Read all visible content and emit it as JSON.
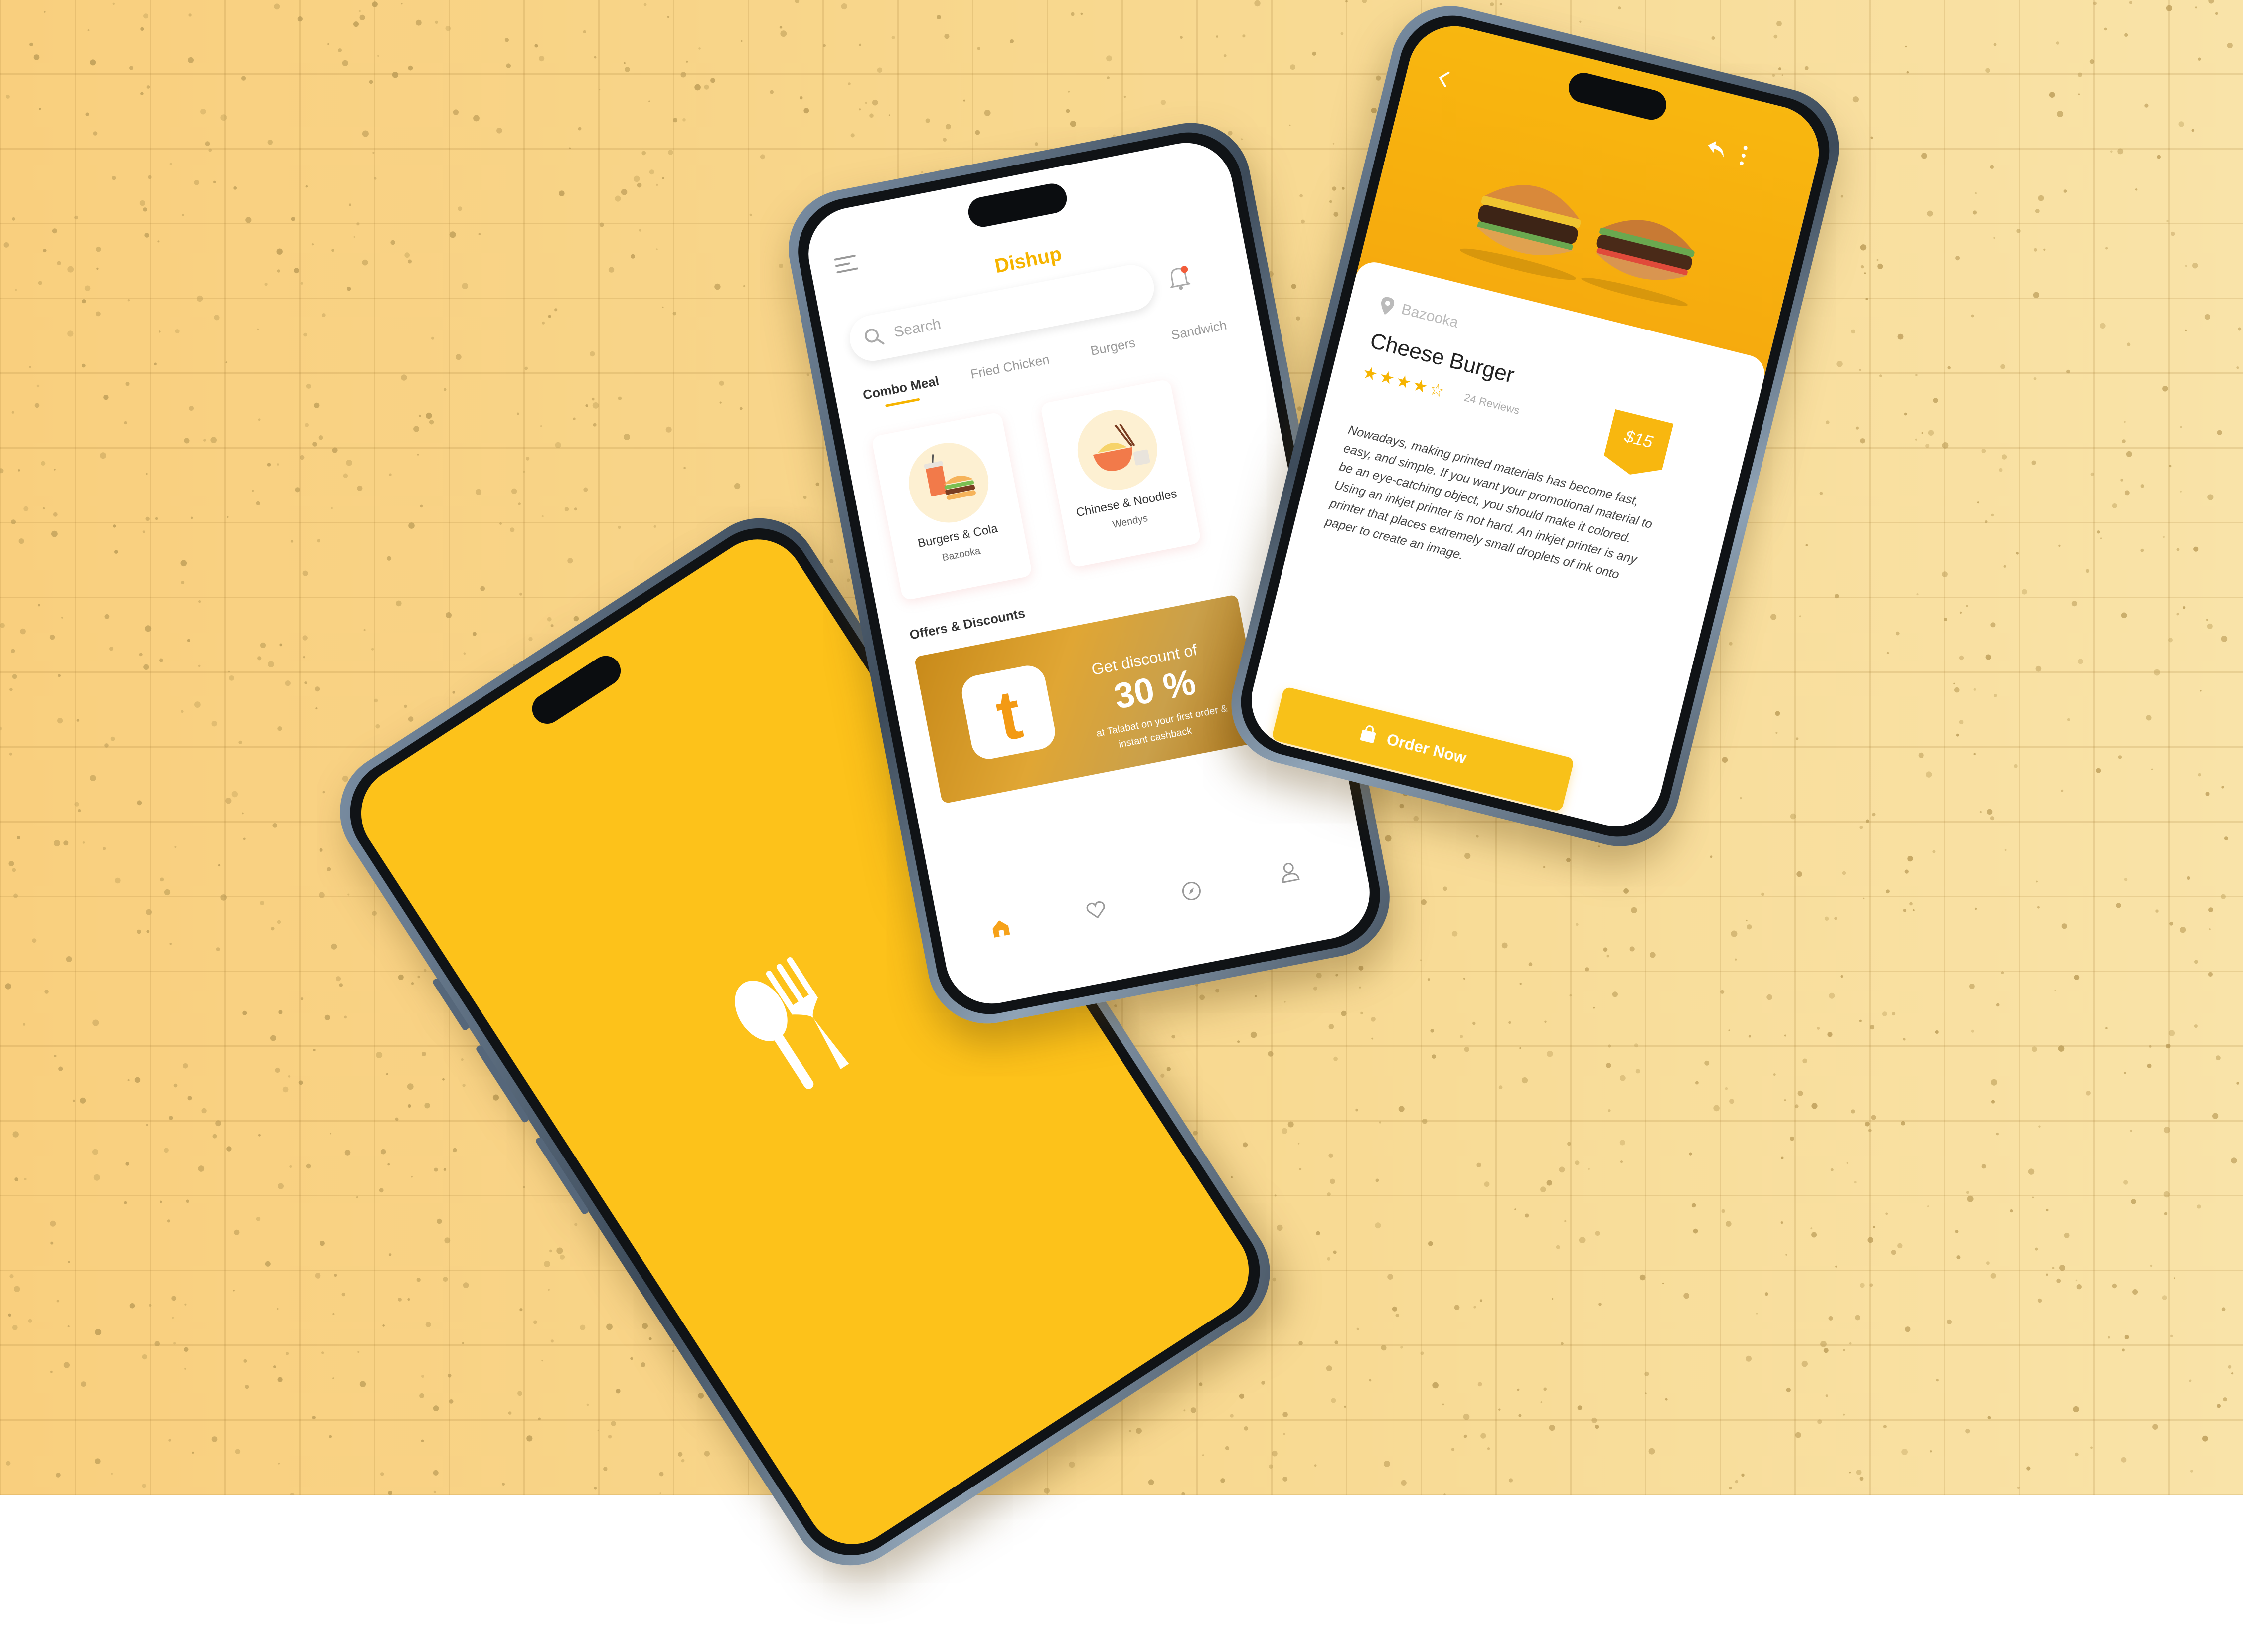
{
  "background": {
    "base_color": "#f9d88f",
    "grid_color": "#a07832",
    "speckle_color": "#b99a55"
  },
  "splash": {
    "bg_color": "#fdc21a",
    "icon": "spoon-fork-icon"
  },
  "home": {
    "app_title": "Dishup",
    "search_placeholder": "Search",
    "tabs": [
      {
        "label": "Combo Meal",
        "active": true
      },
      {
        "label": "Fried Chicken",
        "active": false
      },
      {
        "label": "Burgers",
        "active": false
      },
      {
        "label": "Sandwich",
        "active": false
      }
    ],
    "cards": [
      {
        "title": "Burgers & Cola",
        "subtitle": "Bazooka"
      },
      {
        "title": "Chinese & Noodles",
        "subtitle": "Wendys"
      }
    ],
    "offers_title": "Offers & Discounts",
    "banner": {
      "logo_letter": "t",
      "line1": "Get discount of",
      "line2": "30 %",
      "line3": "at Talabat on your first order &",
      "line4": "instant cashback"
    },
    "nav": [
      "home-icon",
      "heart-icon",
      "compass-icon",
      "profile-icon"
    ],
    "accent_color": "#f6b400"
  },
  "detail": {
    "location": "Bazooka",
    "title": "Cheese Burger",
    "rating": 4,
    "stars": "★★★★☆",
    "reviews": "24 Reviews",
    "price": "$15",
    "description": "Nowadays, making printed materials has become fast, easy, and simple. If you want your promotional material to be an eye-catching object, you should make it colored. Using an inkjet printer is not hard. An inkjet printer is any printer that places extremely small droplets of ink onto paper to create an image.",
    "order_label": "Order Now",
    "accent_color": "#f8c119"
  }
}
